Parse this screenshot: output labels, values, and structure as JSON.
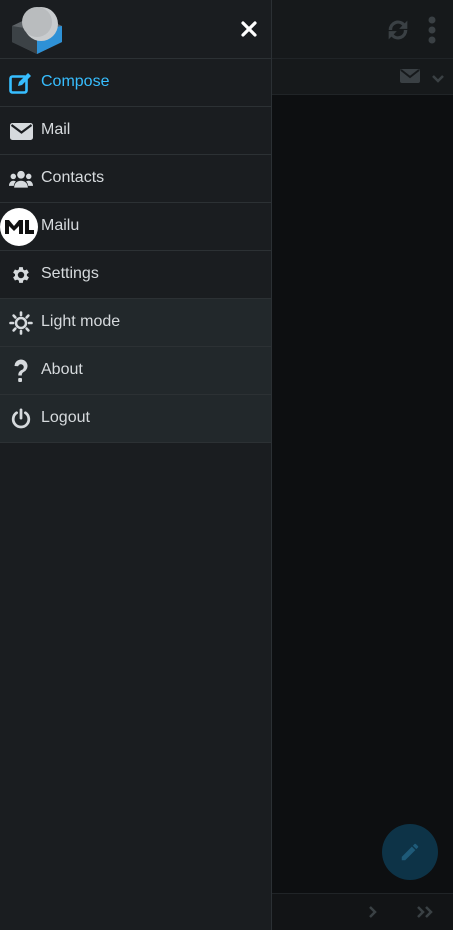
{
  "menu": {
    "items": [
      {
        "id": "compose",
        "label": "Compose",
        "icon": "compose-icon",
        "active": true
      },
      {
        "id": "mail",
        "label": "Mail",
        "icon": "envelope-icon"
      },
      {
        "id": "contacts",
        "label": "Contacts",
        "icon": "users-icon"
      },
      {
        "id": "mailu",
        "label": "Mailu",
        "icon": "mailu-logo-icon"
      },
      {
        "id": "settings",
        "label": "Settings",
        "icon": "gear-icon"
      },
      {
        "id": "light-mode",
        "label": "Light mode",
        "icon": "sun-icon"
      },
      {
        "id": "about",
        "label": "About",
        "icon": "question-icon"
      },
      {
        "id": "logout",
        "label": "Logout",
        "icon": "power-icon"
      }
    ]
  },
  "colors": {
    "accent": "#37beff",
    "drawer_bg": "#1a1d20",
    "text": "#d6dadd"
  }
}
